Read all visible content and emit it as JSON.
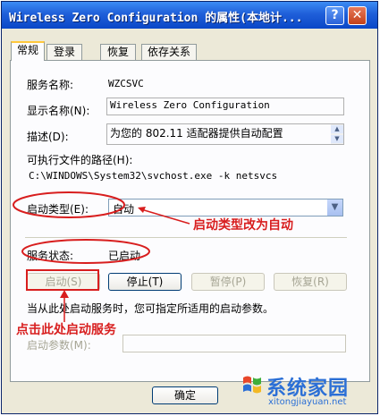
{
  "window": {
    "title": "Wireless Zero Configuration 的属性(本地计..."
  },
  "titlebar": {
    "help_label": "?",
    "close_label": "✕"
  },
  "tabs": [
    {
      "label": "常规"
    },
    {
      "label": "登录"
    },
    {
      "label": "恢复"
    },
    {
      "label": "依存关系"
    }
  ],
  "general": {
    "service_name_label": "服务名称:",
    "service_name": "WZCSVC",
    "display_name_label": "显示名称(N):",
    "display_name": "Wireless Zero Configuration",
    "description_label": "描述(D):",
    "description": "为您的 802.11 适配器提供自动配置",
    "path_label": "可执行文件的路径(H):",
    "path": "C:\\WINDOWS\\System32\\svchost.exe -k netsvcs",
    "startup_type_label": "启动类型(E):",
    "startup_type": "自动",
    "service_status_label": "服务状态:",
    "service_status": "已启动",
    "start_button": "启动(S)",
    "stop_button": "停止(T)",
    "pause_button": "暂停(P)",
    "resume_button": "恢复(R)",
    "hint": "当从此处启动服务时，您可指定所适用的启动参数。",
    "start_params_label": "启动参数(M):",
    "start_params_value": ""
  },
  "footer": {
    "ok_button": "确定"
  },
  "annotations": {
    "startup_note": "启动类型改为自动",
    "start_note": "点击此处启动服务"
  },
  "watermark": {
    "name": "系统家园",
    "url": "xitongjiayuan.net"
  },
  "colors": {
    "annotation": "#d81e1e",
    "titlebar": "#1f5fd9"
  }
}
